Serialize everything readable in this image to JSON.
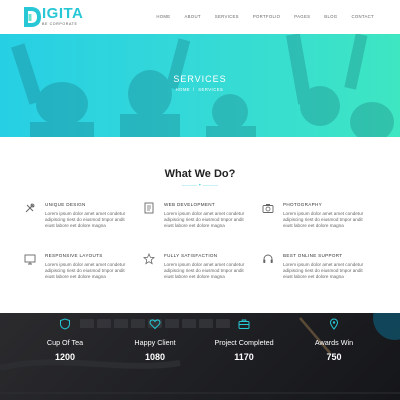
{
  "brand": {
    "name": "IGITA",
    "tagline": "BE CORPORATE",
    "accent": "#27c7d6"
  },
  "nav": {
    "items": [
      "HOME",
      "ABOUT",
      "SERVICES",
      "PORTFOLIO",
      "PAGES",
      "BLOG",
      "CONTACT"
    ]
  },
  "hero": {
    "title": "SERVICES",
    "breadcrumb": [
      "HOME",
      "SERVICES"
    ],
    "gradient": [
      "#27cfe4",
      "#3ee6c2"
    ]
  },
  "what_we_do": {
    "title": "What We Do?",
    "subtitle": "———— ✦ ————",
    "services": [
      {
        "title": "UNIQUE DESIGN",
        "icon": "tools-icon",
        "desc": "Lorem ipsum dolor amet amet condetur adipiscing riest do eiusmod tmpor andit eiust labore eet dolore magna"
      },
      {
        "title": "WEB DEVELOPMENT",
        "icon": "code-document-icon",
        "desc": "Lorem ipsum dolor amet amet condetur adipiscing riest do eiusmod tmpor andit eiust labore eet dolore magna"
      },
      {
        "title": "PHOTOGRAPHY",
        "icon": "camera-icon",
        "desc": "Lorem ipsum dolor amet amet condetur adipiscing riest do eiusmod tmpor andit eiust labore eet dolore magna"
      },
      {
        "title": "RESPONSIVE LAYOUTS",
        "icon": "monitor-icon",
        "desc": "Lorem ipsum dolor amet amet condetur adipiscing riest do eiusmod tmpor andit eiust labore eet dolore magna"
      },
      {
        "title": "FULLY SATISFACTION",
        "icon": "star-icon",
        "desc": "Lorem ipsum dolor amet amet condetur adipiscing riest do eiusmod tmpor andit eiust labore eet dolore magna"
      },
      {
        "title": "BEST ONLINE SUPPORT",
        "icon": "headset-icon",
        "desc": "Lorem ipsum dolor amet amet condetur adipiscing riest do eiusmod tmpor andit eiust labore eet dolore magna"
      }
    ]
  },
  "counters": [
    {
      "label": "Cup Of Tea",
      "value": "1200",
      "icon": "shield-icon"
    },
    {
      "label": "Happy Client",
      "value": "1080",
      "icon": "heart-icon"
    },
    {
      "label": "Project Completed",
      "value": "1170",
      "icon": "briefcase-icon"
    },
    {
      "label": "Awards Win",
      "value": "750",
      "icon": "map-pin-icon"
    }
  ]
}
